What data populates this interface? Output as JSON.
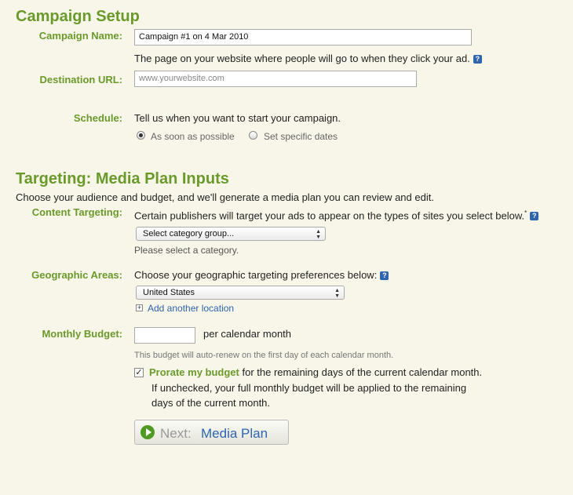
{
  "campaign_setup": {
    "heading": "Campaign Setup",
    "name_label": "Campaign Name:",
    "name_value": "Campaign #1 on 4 Mar 2010",
    "url_help_text": "The page on your website where people will go to when they click your ad.",
    "url_label": "Destination URL:",
    "url_placeholder": "www.yourwebsite.com",
    "schedule_label": "Schedule:",
    "schedule_text": "Tell us when you want to start your campaign.",
    "schedule_options": [
      "As soon as possible",
      "Set specific dates"
    ],
    "schedule_selected": "As soon as possible"
  },
  "targeting": {
    "heading": "Targeting: Media Plan Inputs",
    "intro": "Choose your audience and budget, and we'll generate a media plan you can review and edit.",
    "content_label": "Content Targeting:",
    "content_text": "Certain publishers will target your ads to appear on the types of sites you select below.",
    "content_asterisk": "*",
    "category_select": "Select category group...",
    "category_hint": "Please select a category.",
    "geo_label": "Geographic Areas:",
    "geo_text": "Choose your geographic targeting preferences below:",
    "geo_select": "United States",
    "add_location": "Add another location",
    "budget_label": "Monthly Budget:",
    "budget_value": "",
    "budget_unit": "per calendar month",
    "budget_note": "This budget will auto-renew on the first day of each calendar month.",
    "prorate_checked": true,
    "prorate_bold": "Prorate my budget",
    "prorate_rest": " for the remaining days of the current calendar month.",
    "prorate_line2": "If unchecked, your full monthly budget will be applied to the remaining",
    "prorate_line3": "days of the current month."
  },
  "next_button": {
    "prefix": "Next:",
    "label": "Media Plan"
  },
  "icons": {
    "help": "help-icon",
    "add": "plus-box-icon",
    "play": "play-circle-icon"
  },
  "colors": {
    "background": "#f8f6e9",
    "heading_green": "#6a9a2a",
    "link_blue": "#2e64b0",
    "button_green": "#4e9a22"
  }
}
